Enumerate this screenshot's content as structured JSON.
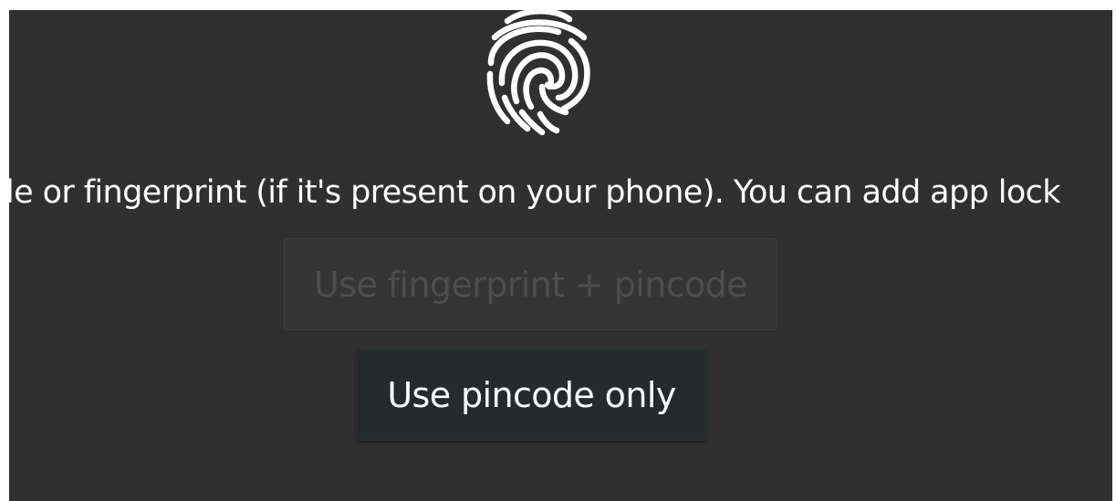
{
  "icon": {
    "name": "fingerprint-icon",
    "color": "#ffffff"
  },
  "description": {
    "text": "le or fingerprint (if it's present on your phone). You can add app lock"
  },
  "buttons": {
    "fingerprint_pincode": {
      "label": "Use fingerprint + pincode",
      "enabled": false
    },
    "pincode_only": {
      "label": "Use pincode only",
      "enabled": true
    }
  },
  "colors": {
    "background": "#303030",
    "disabled_text": "#4d4d4d",
    "primary_text": "#ffffff",
    "button_dark": "#252a2c"
  }
}
